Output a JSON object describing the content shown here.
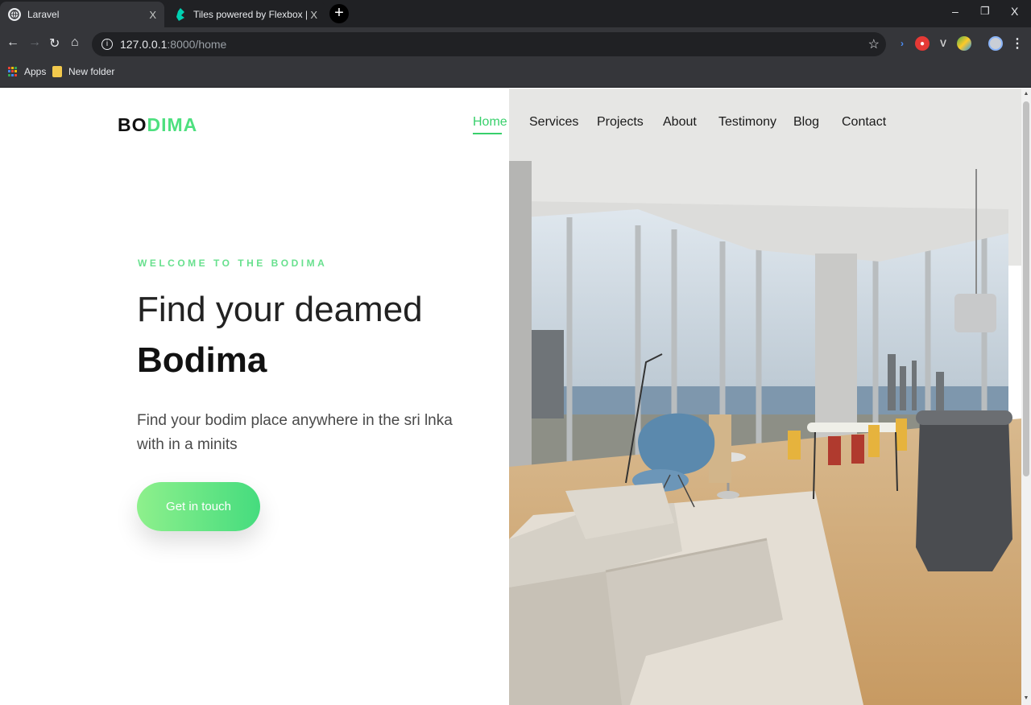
{
  "browser": {
    "tabs": [
      {
        "title": "Laravel",
        "close": "X",
        "active": true
      },
      {
        "title": "Tiles powered by Flexbox | Bulma",
        "close": "X",
        "active": false
      }
    ],
    "new_tab": "+",
    "window_controls": {
      "minimize": "–",
      "restore": "❐",
      "close": "X"
    },
    "url": {
      "host": "127.0.0.1",
      "path": ":8000/home"
    },
    "bookmarks": [
      {
        "label": "Apps",
        "icon": "apps-grid-icon"
      },
      {
        "label": "New folder",
        "icon": "folder-icon"
      }
    ]
  },
  "site": {
    "logo": {
      "part1": "BO",
      "part2": "DIMA"
    },
    "nav": [
      "Home",
      "Services",
      "Projects",
      "About",
      "Testimony",
      "Blog",
      "Contact"
    ],
    "active_nav": "Home",
    "hero": {
      "eyebrow": "WELCOME TO THE BODIMA",
      "title_line1": "Find your deamed",
      "title_line2": "Bodima",
      "description": "Find your bodim place anywhere in the sri lnka with in a minits",
      "cta": "Get in touch"
    }
  },
  "colors": {
    "accent": "#38d06b",
    "logo_green": "#4ee07f",
    "chrome_dark": "#202124",
    "chrome_mid": "#35363a"
  }
}
